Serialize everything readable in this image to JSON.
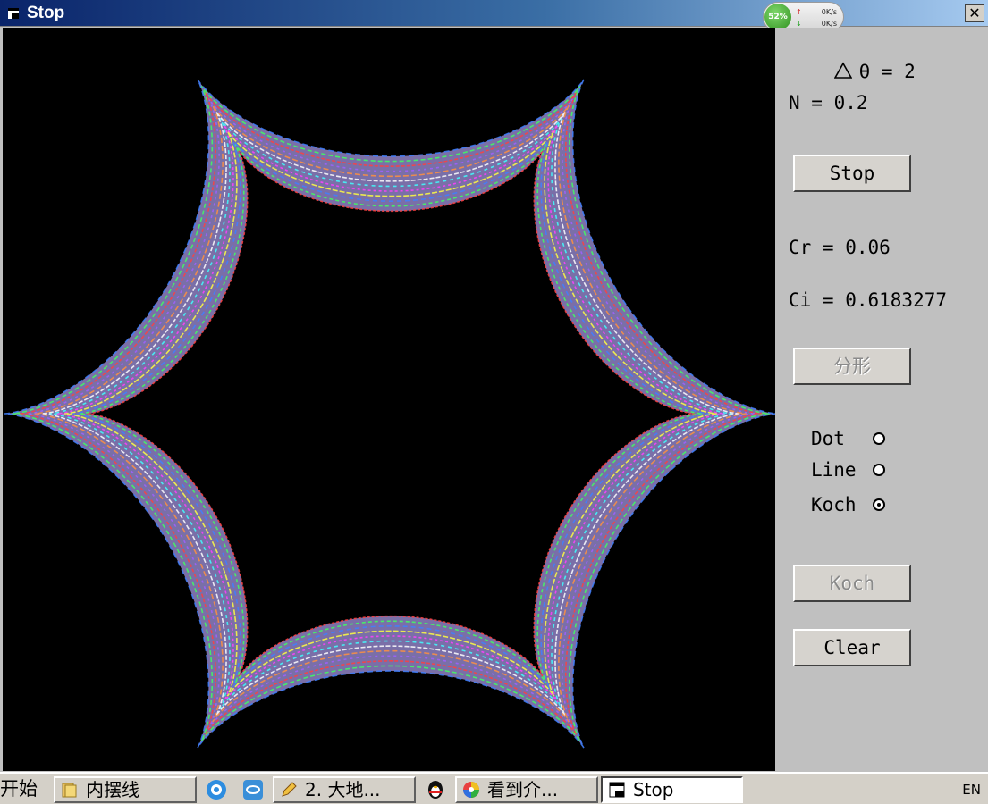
{
  "window": {
    "title": "Stop",
    "close_symbol": "✕"
  },
  "net_widget": {
    "percent": "52%",
    "up_speed": "0K/s",
    "down_speed": "0K/s"
  },
  "panel": {
    "theta_label": "θ = 2",
    "n_label": "N = 0.2",
    "stop_button": "Stop",
    "cr_label": "Cr = 0.06",
    "ci_label": "Ci = 0.6183277",
    "fractal_button": "分形",
    "radios": [
      {
        "label": "Dot",
        "checked": false
      },
      {
        "label": "Line",
        "checked": false
      },
      {
        "label": "Koch",
        "checked": true
      }
    ],
    "koch_button": "Koch",
    "clear_button": "Clear"
  },
  "taskbar": {
    "start": "开始",
    "items": [
      {
        "label": "内摆线"
      },
      {
        "label": "2. 大地..."
      },
      {
        "label": "看到介..."
      },
      {
        "label": "Stop"
      }
    ],
    "language": "EN"
  },
  "colors": {
    "canvas_bg": "#000000",
    "panel_bg": "#c0c0c0",
    "title_gradient_start": "#0a246a",
    "title_gradient_end": "#a6caf0"
  }
}
